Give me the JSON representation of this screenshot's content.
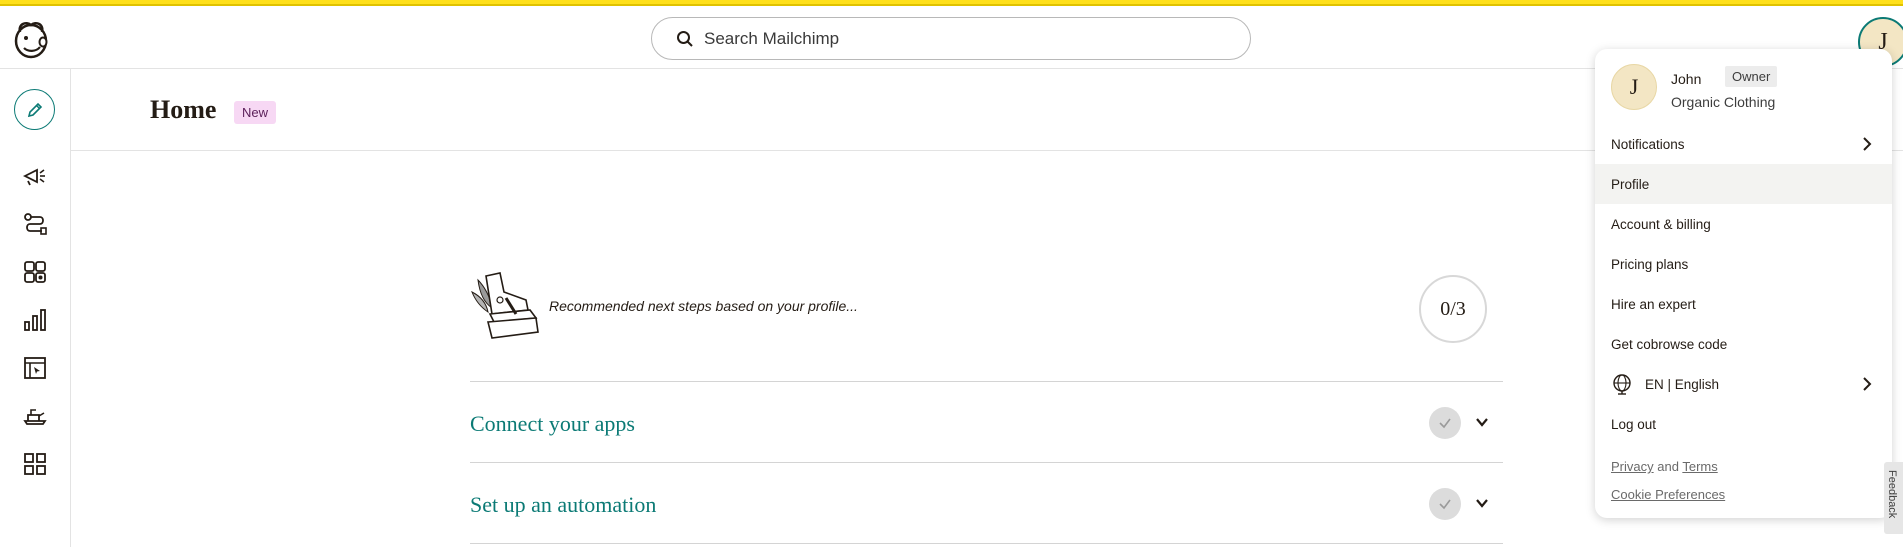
{
  "header": {
    "search_placeholder": "Search Mailchimp",
    "avatar_initial": "J"
  },
  "colors": {
    "brand_yellow": "#ffe01b",
    "accent_teal": "#0b7a75",
    "badge_new_bg": "#f7d8f4"
  },
  "sidebar": {
    "items": [
      {
        "icon": "create-pencil-icon"
      },
      {
        "icon": "campaigns-megaphone-icon"
      },
      {
        "icon": "automations-flow-icon"
      },
      {
        "icon": "audience-icon"
      },
      {
        "icon": "analytics-bar-chart-icon"
      },
      {
        "icon": "website-icon"
      },
      {
        "icon": "content-studio-icon"
      },
      {
        "icon": "integrations-grid-icon"
      }
    ]
  },
  "page": {
    "title": "Home",
    "new_badge": "New"
  },
  "steps": {
    "intro_text": "Recommended next steps based on your profile...",
    "progress": "0/3",
    "items": [
      {
        "title": "Connect your apps"
      },
      {
        "title": "Set up an automation"
      }
    ]
  },
  "account_menu": {
    "avatar_initial": "J",
    "user_name": "John",
    "role": "Owner",
    "org": "Organic Clothing",
    "items": [
      {
        "label": "Notifications"
      },
      {
        "label": "Profile"
      },
      {
        "label": "Account & billing"
      },
      {
        "label": "Pricing plans"
      },
      {
        "label": "Hire an expert"
      },
      {
        "label": "Get cobrowse code"
      },
      {
        "label": "EN | English"
      },
      {
        "label": "Log out"
      }
    ],
    "footer": {
      "privacy": "Privacy",
      "and": "and",
      "terms": "Terms",
      "cookie": "Cookie Preferences"
    }
  },
  "feedback_tab": "Feedback"
}
